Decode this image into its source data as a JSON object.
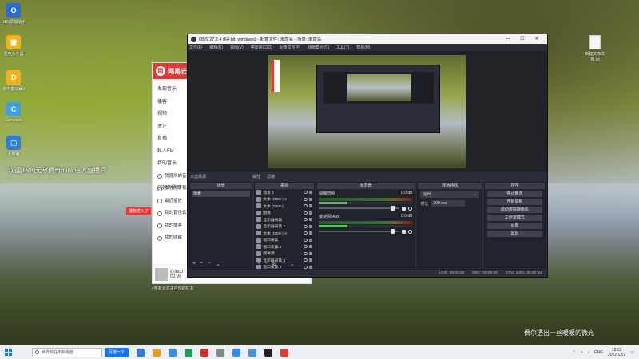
{
  "desktop": {
    "icons": [
      {
        "label": "OBS录播助手",
        "color": "#2b6bd6",
        "glyph": "O"
      },
      {
        "label": "雷电多开器",
        "color": "#f2b01e",
        "glyph": "雷"
      },
      {
        "label": "雷电模拟器9",
        "color": "#f2b01e",
        "glyph": "D"
      },
      {
        "label": "Complete",
        "color": "#3aa0e0",
        "glyph": "C"
      },
      {
        "label": "此电脑",
        "color": "#2f7fd8",
        "glyph": "▢"
      }
    ],
    "doc_icon_label": "新建文本文档.txt",
    "danmu": "欢迎[LV8]无敌佩奇mink进入直播间",
    "red_tag": "播放进入了",
    "music_bottom_text": "4条新消息来自你的好友",
    "caption": "偶尔透出一丝暖暖的微光"
  },
  "music": {
    "app_name": "网易云音乐",
    "nav": [
      "发现音乐",
      "播客",
      "视频",
      "关注",
      "直播",
      "私人FM"
    ],
    "section": "我的音乐",
    "my": [
      "我喜欢的音乐",
      "本地与下载",
      "最近播放",
      "我的音乐云盘",
      "我的播客",
      "我的收藏"
    ],
    "created_label": "创建的歌单",
    "player_title": "心海DJ",
    "player_artist": "DJ Mi"
  },
  "obs": {
    "title": "OBS 27.2.4 (64-bit, windows) - 配置文件: 未命名 - 场景: 未命名",
    "menu": [
      "文件(F)",
      "编辑(E)",
      "视图(V)",
      "停靠窗口(D)",
      "配置文件(P)",
      "场景集合(S)",
      "工具(T)",
      "帮助(H)"
    ],
    "window_buttons": [
      "—",
      "☐",
      "✕"
    ],
    "toolrow_label": "未选择源",
    "toolrow_properties": "属性",
    "toolrow_filters": "滤镜",
    "scenes_header": "场景",
    "scene_item": "场景",
    "sources_header": "来源",
    "sources": [
      "场景 2",
      "文本 (GDI+) 2",
      "文本 (GDI+)",
      "图像",
      "显示器采集",
      "显示器采集 2",
      "文本 (GDI+) 3",
      "窗口采集",
      "窗口采集 2",
      "媒体源",
      "显示器采集 3",
      "窗口采集 3"
    ],
    "mixer_header": "混音器",
    "tracks": [
      {
        "name": "桌面音频",
        "db": "0.0 dB"
      },
      {
        "name": "麦克风/Aux",
        "db": "0.0 dB"
      }
    ],
    "transitions_header": "转场特效",
    "transition_selected": "淡出",
    "duration_label": "时长",
    "duration_value": "300 ms",
    "controls_header": "控件",
    "controls": [
      "停止推流",
      "开始录制",
      "启动虚拟摄像机",
      "工作室模式",
      "设置",
      "退出"
    ],
    "status": {
      "live": "LIVE: 00:00:00",
      "rec": "REC: 00:00:00",
      "cpu": "CPU: 1.0%, 30.00 fps"
    }
  },
  "taskbar": {
    "search_placeholder": "世界都在用新电脑...",
    "hot_label": "百度一下",
    "app_colors": [
      "#2f7fd8",
      "#e0a21e",
      "#3a8ee6",
      "#1a9e5c",
      "#d93025",
      "#888888",
      "#2d8cff",
      "#4a90e2",
      "#222222",
      "#e53935"
    ],
    "lang": "ENG",
    "time": "18:53",
    "date": "2022/12/2"
  }
}
